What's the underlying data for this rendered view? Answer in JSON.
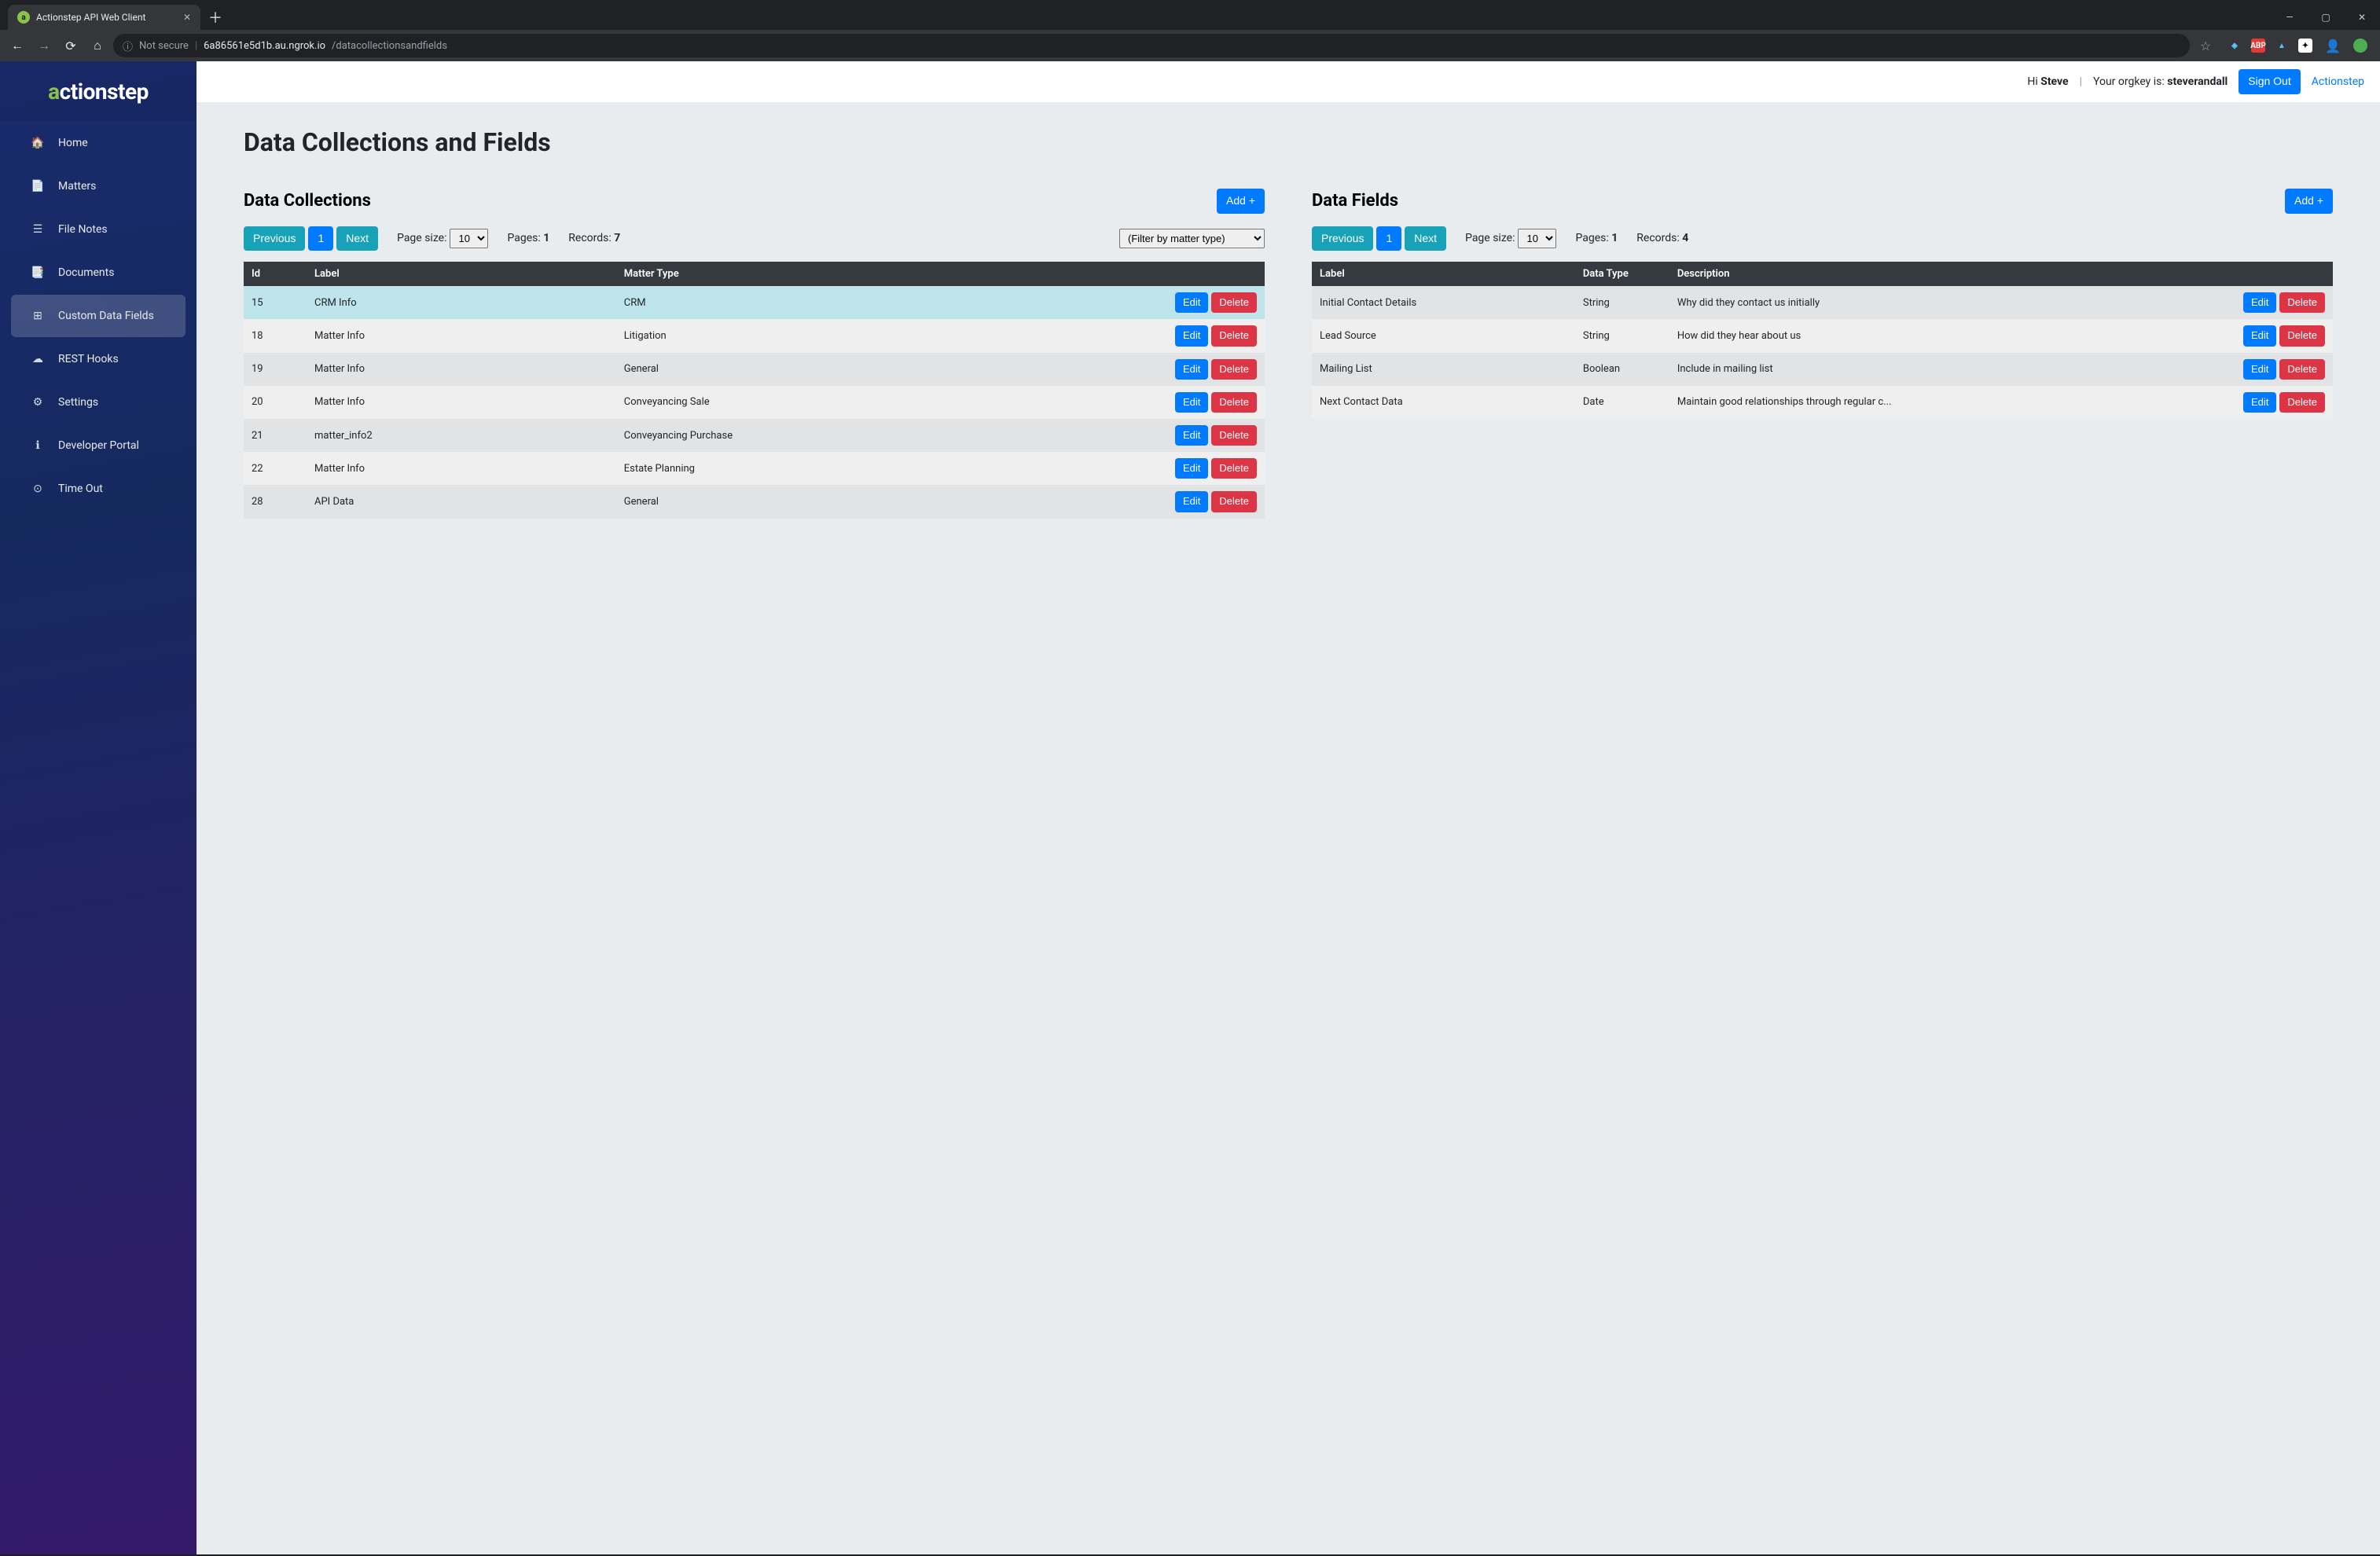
{
  "browser": {
    "tab_title": "Actionstep API Web Client",
    "not_secure": "Not secure",
    "url_host": "6a86561e5d1b.au.ngrok.io",
    "url_path": "/datacollectionsandfields"
  },
  "header": {
    "greeting_prefix": "Hi ",
    "user": "Steve",
    "orgkey_prefix": "Your orgkey is: ",
    "orgkey": "steverandall",
    "signout": "Sign Out",
    "brand_link": "Actionstep"
  },
  "logo": {
    "a": "a",
    "rest": "ctionstep"
  },
  "sidebar": {
    "items": [
      {
        "label": "Home"
      },
      {
        "label": "Matters"
      },
      {
        "label": "File Notes"
      },
      {
        "label": "Documents"
      },
      {
        "label": "Custom Data Fields"
      },
      {
        "label": "REST Hooks"
      },
      {
        "label": "Settings"
      },
      {
        "label": "Developer Portal"
      },
      {
        "label": "Time Out"
      }
    ],
    "active_index": 4
  },
  "page": {
    "title": "Data Collections and Fields"
  },
  "common": {
    "add": "Add +",
    "edit": "Edit",
    "delete": "Delete",
    "previous": "Previous",
    "page_1": "1",
    "next": "Next",
    "page_size_label": "Page size:",
    "page_size_value": "10",
    "pages_label": "Pages:",
    "records_label": "Records:"
  },
  "collections": {
    "title": "Data Collections",
    "filter_placeholder": "(Filter by matter type)",
    "pages": "1",
    "records": "7",
    "columns": {
      "id": "Id",
      "label": "Label",
      "matter_type": "Matter Type"
    },
    "selected_id": "15",
    "rows": [
      {
        "id": "15",
        "label": "CRM Info",
        "matter_type": "CRM"
      },
      {
        "id": "18",
        "label": "Matter Info",
        "matter_type": "Litigation"
      },
      {
        "id": "19",
        "label": "Matter Info",
        "matter_type": "General"
      },
      {
        "id": "20",
        "label": "Matter Info",
        "matter_type": "Conveyancing Sale"
      },
      {
        "id": "21",
        "label": "matter_info2",
        "matter_type": "Conveyancing Purchase"
      },
      {
        "id": "22",
        "label": "Matter Info",
        "matter_type": "Estate Planning"
      },
      {
        "id": "28",
        "label": "API Data",
        "matter_type": "General"
      }
    ]
  },
  "fields": {
    "title": "Data Fields",
    "pages": "1",
    "records": "4",
    "columns": {
      "label": "Label",
      "data_type": "Data Type",
      "description": "Description"
    },
    "rows": [
      {
        "label": "Initial Contact Details",
        "data_type": "String",
        "description": "Why did they contact us initially"
      },
      {
        "label": "Lead Source",
        "data_type": "String",
        "description": "How did they hear about us"
      },
      {
        "label": "Mailing List",
        "data_type": "Boolean",
        "description": "Include in mailing list"
      },
      {
        "label": "Next Contact Data",
        "data_type": "Date",
        "description": "Maintain good relationships through regular c..."
      }
    ]
  }
}
